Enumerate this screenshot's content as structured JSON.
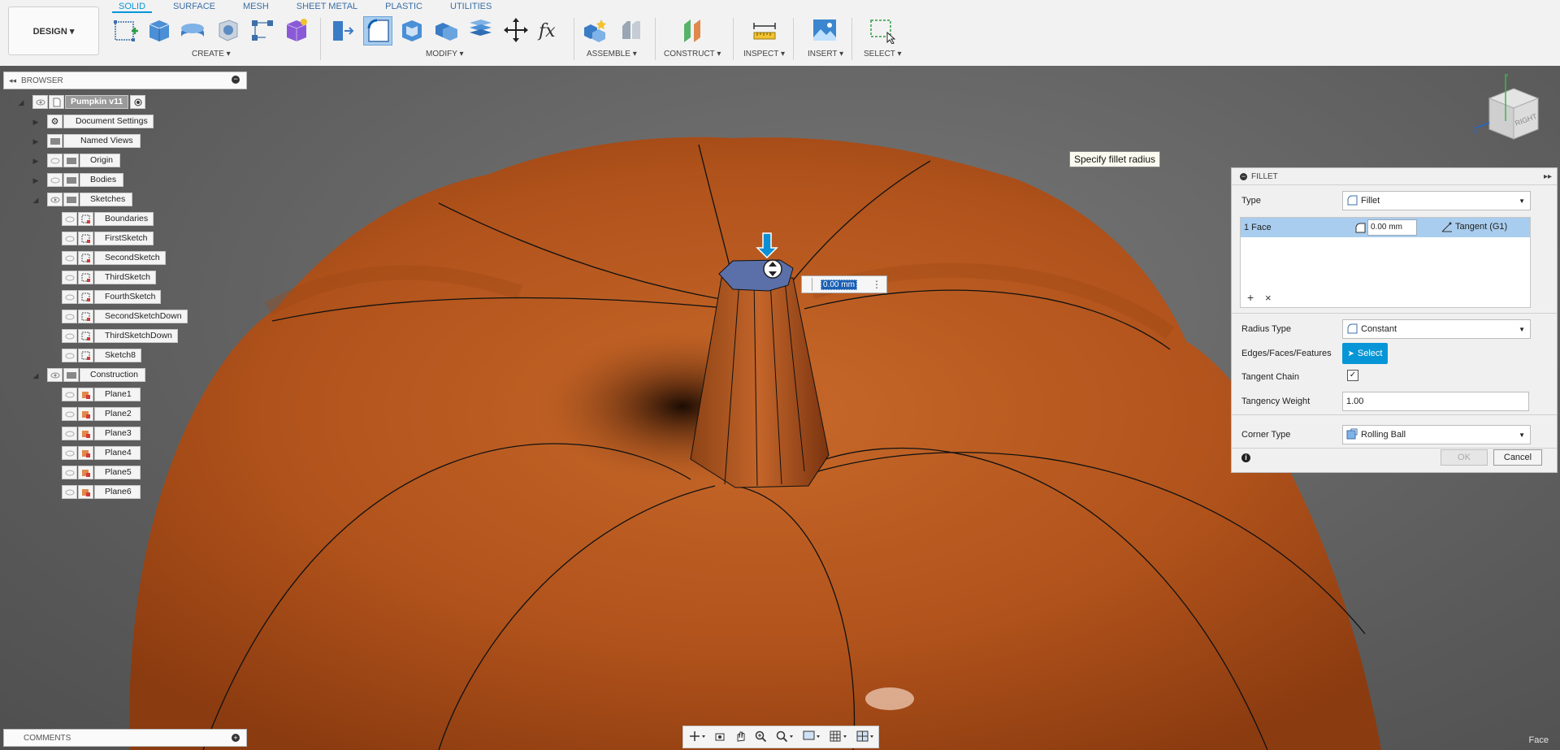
{
  "toolbar": {
    "workspace_label": "DESIGN ▾",
    "tabs": [
      "SOLID",
      "SURFACE",
      "MESH",
      "SHEET METAL",
      "PLASTIC",
      "UTILITIES"
    ],
    "groups": {
      "create": "CREATE ▾",
      "modify": "MODIFY ▾",
      "assemble": "ASSEMBLE ▾",
      "construct": "CONSTRUCT ▾",
      "inspect": "INSPECT ▾",
      "insert": "INSERT ▾",
      "select": "SELECT ▾"
    }
  },
  "browser": {
    "title": "BROWSER",
    "root": "Pumpkin v11",
    "nodes": {
      "document_settings": "Document Settings",
      "named_views": "Named Views",
      "origin": "Origin",
      "bodies": "Bodies",
      "sketches": "Sketches",
      "construction": "Construction"
    },
    "sketches": [
      "Boundaries",
      "FirstSketch",
      "SecondSketch",
      "ThirdSketch",
      "FourthSketch",
      "SecondSketchDown",
      "ThirdSketchDown",
      "Sketch8"
    ],
    "planes": [
      "Plane1",
      "Plane2",
      "Plane3",
      "Plane4",
      "Plane5",
      "Plane6"
    ]
  },
  "comments": {
    "title": "COMMENTS"
  },
  "viewport": {
    "tooltip": "Specify fillet radius",
    "radius_value": "0.00 mm",
    "status_right": "Face",
    "viewcube_face": "RIGHT",
    "axis_y": "Y",
    "axis_z": "Z"
  },
  "fillet": {
    "title": "FILLET",
    "type_label": "Type",
    "type_value": "Fillet",
    "selection": {
      "count_label": "1 Face",
      "radius": "0.00 mm",
      "continuity": "Tangent (G1)"
    },
    "radius_type_label": "Radius Type",
    "radius_type_value": "Constant",
    "edges_label": "Edges/Faces/Features",
    "select_button": "Select",
    "tangent_chain_label": "Tangent Chain",
    "tangent_chain_checked": true,
    "tangency_weight_label": "Tangency Weight",
    "tangency_weight_value": "1.00",
    "corner_type_label": "Corner Type",
    "corner_type_value": "Rolling Ball",
    "ok_label": "OK",
    "cancel_label": "Cancel"
  },
  "colors": {
    "accent": "#0696d7",
    "pumpkin": "#b4561d",
    "selected_face": "#5b6fa8",
    "selection_row": "#a9cdee"
  },
  "icons": [
    "sketch-icon",
    "extrude-icon",
    "revolve-icon",
    "hole-icon",
    "pattern-icon",
    "form-icon",
    "press-pull-icon",
    "fillet-icon",
    "shell-icon",
    "combine-icon",
    "scale-icon",
    "move-icon",
    "parameters-icon",
    "new-component-icon",
    "joint-icon",
    "offset-plane-icon",
    "measure-icon",
    "insert-image-icon",
    "select-window-icon",
    "eye-icon",
    "gear-icon",
    "folder-icon",
    "sketch-node-icon",
    "plane-icon",
    "orbit-icon",
    "pan-icon",
    "zoom-icon",
    "display-icon",
    "grid-icon",
    "viewports-icon"
  ]
}
